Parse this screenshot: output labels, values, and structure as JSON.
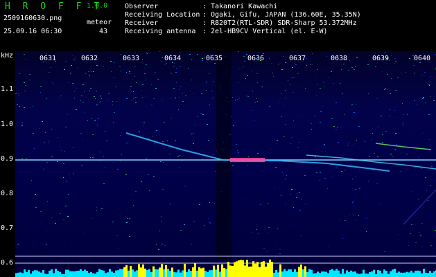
{
  "header": {
    "app_name": "H R O F F T",
    "version": "1.0.0",
    "file_name": "2509160630.png",
    "meteor_label": "meteor",
    "timestamp": "25.09.16 06:30",
    "meteor_count": "43"
  },
  "info": {
    "observer_key": "Observer",
    "observer_value": "Takanori Kawachi",
    "location_key": "Receiving Location",
    "location_value": "Ogaki, Gifu, JAPAN (136.60E, 35.35N)",
    "receiver_key": "Receiver",
    "receiver_value": "R820T2(RTL-SDR) SDR-Sharp 53.372MHz",
    "antenna_key": "Receiving antenna",
    "antenna_value": "2el-HB9CV Vertical (el. E-W)",
    "colon": ":"
  },
  "axis": {
    "unit": "kHz",
    "ticks": [
      "1.1",
      "1.0",
      "0.9",
      "0.8",
      "0.7",
      "0.6"
    ],
    "time_labels": [
      "0631",
      "0632",
      "0633",
      "0634",
      "0635",
      "0636",
      "0637",
      "0638",
      "0639",
      "0640"
    ]
  },
  "colors": {
    "title_green": "#19d419",
    "spectrogram_bg": "#00003a",
    "carrier_cyan": "#7fd6ff",
    "bottom_yellow": "#ffff00",
    "bottom_cyan": "#00ffff"
  }
}
